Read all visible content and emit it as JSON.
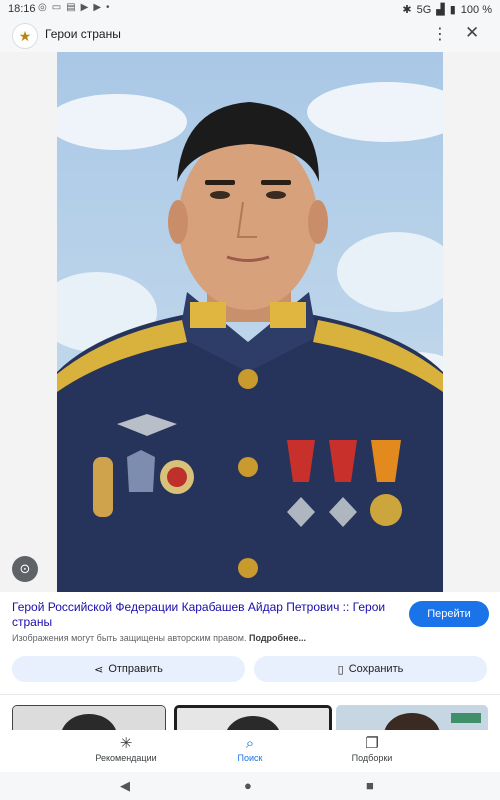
{
  "status_bar": {
    "time": "18:16",
    "network": "5G",
    "battery": "100 %"
  },
  "header": {
    "title": "Герои страны",
    "logo_icon": "star-icon"
  },
  "main": {
    "caption": "Герой Российской Федерации Карабашев Айдар Петрович :: Герои страны",
    "visit_label": "Перейти",
    "copyright_text": "Изображения могут быть защищены авторским правом.",
    "copyright_more": "Подробнее...",
    "share_label": "Отправить",
    "save_label": "Сохранить"
  },
  "bottom_nav": {
    "items": [
      {
        "label": "Рекомендации",
        "icon": "asterisk-icon"
      },
      {
        "label": "Поиск",
        "icon": "search-icon",
        "active": true
      },
      {
        "label": "Подборки",
        "icon": "collections-icon"
      }
    ]
  },
  "colors": {
    "accent": "#1a73e8",
    "chip_bg": "#e8f0fe",
    "bar_bg": "#f6f7f9"
  }
}
